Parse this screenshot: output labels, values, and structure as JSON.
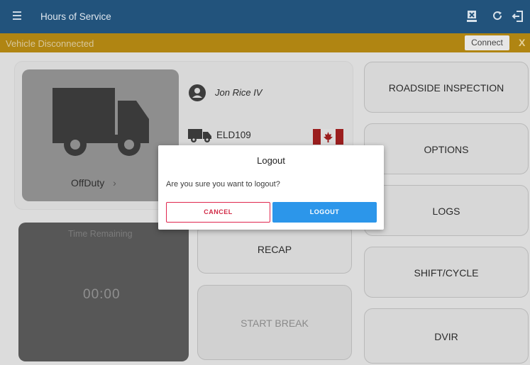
{
  "appbar": {
    "title": "Hours of Service",
    "icons": [
      "menu-icon",
      "eld-device-icon",
      "refresh-icon",
      "logout-icon"
    ]
  },
  "banner": {
    "message": "Vehicle Disconnected",
    "connect_label": "Connect",
    "close_label": "X"
  },
  "status": {
    "duty_status": "OffDuty",
    "driver_name": "Jon Rice IV",
    "vehicle_name": "ELD109",
    "region_flag": "canada-flag"
  },
  "timer": {
    "label": "Time Remaining",
    "value": "00:00"
  },
  "actions": {
    "recap": "RECAP",
    "start_break": "START BREAK",
    "roadside": "ROADSIDE INSPECTION",
    "options": "OPTIONS",
    "logs": "LOGS",
    "shift_cycle": "SHIFT/CYCLE",
    "dvir": "DVIR"
  },
  "dialog": {
    "title": "Logout",
    "message": "Are you sure you want to logout?",
    "cancel_label": "CANCEL",
    "logout_label": "LOGOUT"
  },
  "colors": {
    "appbar": "#22537c",
    "banner": "#b08512",
    "cancel_accent": "#e0264e",
    "logout_accent": "#2c96ea"
  }
}
